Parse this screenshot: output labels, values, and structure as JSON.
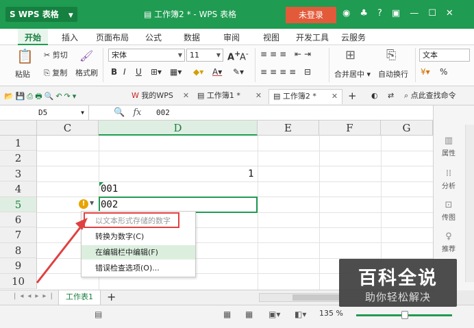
{
  "titlebar": {
    "app_name": "WPS 表格",
    "doc_title": "工作簿2 * - WPS 表格",
    "login_label": "未登录",
    "help_label": "?",
    "window_controls": [
      "minimize",
      "maximize",
      "close"
    ]
  },
  "menu": {
    "items": [
      "开始",
      "插入",
      "页面布局",
      "公式",
      "数据",
      "审阅",
      "视图",
      "开发工具",
      "云服务"
    ],
    "active": "开始"
  },
  "ribbon": {
    "paste": "粘贴",
    "cut": "剪切",
    "copy": "复制",
    "format_painter": "格式刷",
    "font_name": "宋体",
    "font_size": "11",
    "bold": "B",
    "italic": "I",
    "underline": "U",
    "merge_center": "合并居中",
    "wrap_text": "自动换行",
    "number_format": "文本",
    "percent": "%",
    "grow_font": "A",
    "shrink_font": "A"
  },
  "tabs": {
    "items": [
      {
        "label": "我的WPS",
        "active": false
      },
      {
        "label": "工作簿1 *",
        "active": false
      },
      {
        "label": "工作簿2 *",
        "active": true
      }
    ],
    "search_label": "点此查找命令"
  },
  "formula_bar": {
    "name_box": "D5",
    "fx_label": "fx",
    "value": "002"
  },
  "grid": {
    "columns": [
      "C",
      "D",
      "E",
      "F",
      "G"
    ],
    "selected_column": "D",
    "rows": [
      "1",
      "2",
      "3",
      "4",
      "5",
      "6",
      "7",
      "8",
      "9",
      "10"
    ],
    "selected_row": "5",
    "cells": {
      "D3": "1",
      "D4": "001",
      "D5": "002"
    }
  },
  "context_menu": {
    "items": [
      {
        "label": "以文本形式存储的数字",
        "disabled": true
      },
      {
        "label": "转换为数字(C)",
        "disabled": false
      },
      {
        "label": "在编辑栏中编辑(F)",
        "disabled": false,
        "highlighted": true
      },
      {
        "label": "错误检查选项(O)...",
        "disabled": false
      }
    ]
  },
  "right_panel": {
    "items": [
      "属性",
      "分析",
      "传图",
      "推荐"
    ]
  },
  "sheet_tabs": {
    "items": [
      "工作表1"
    ],
    "add_label": "+"
  },
  "status": {
    "zoom": "135 %"
  },
  "watermark": {
    "title": "百科全说",
    "subtitle": "助你轻松解决"
  },
  "colors": {
    "brand_green": "#1f9b52",
    "login_red": "#e25a3a",
    "annotation_red": "#e04040"
  }
}
